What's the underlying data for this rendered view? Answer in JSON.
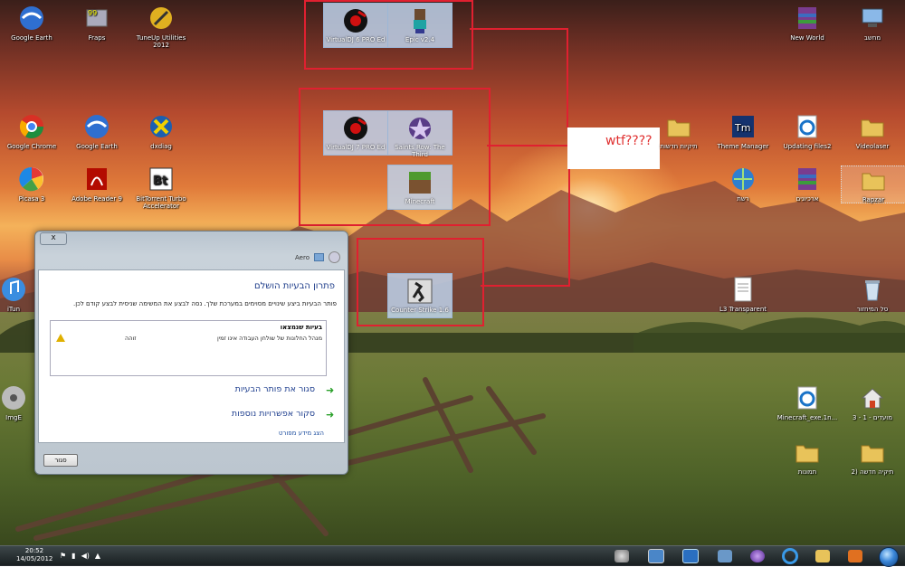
{
  "desktop": {
    "icons_left": [
      {
        "label": "Google Earth"
      },
      {
        "label": "Fraps",
        "badge": "99"
      },
      {
        "label": "TuneUp Utilities 2012"
      },
      {
        "label": "Google Chrome"
      },
      {
        "label": "Google Earth"
      },
      {
        "label": "dxdiag"
      },
      {
        "label": "Picasa 3"
      },
      {
        "label": "Adobe Reader 9"
      },
      {
        "label": "BitTorrent Turbo Accelerator"
      },
      {
        "label": "iTun"
      },
      {
        "label": "ImgE"
      }
    ],
    "icons_middle": [
      {
        "label": "VirtualDJ 6 PRO Ed"
      },
      {
        "label": "Epic v2.4"
      },
      {
        "label": "VirtualDJ 7 PRO Ed"
      },
      {
        "label": "Saints Row: The Third"
      },
      {
        "label": "Minecraft"
      },
      {
        "label": "Counter Strike 1.6"
      }
    ],
    "icons_right": [
      {
        "label": "New World"
      },
      {
        "label": "מחשב"
      },
      {
        "label": "תיקיות חדשות"
      },
      {
        "label": "Theme Manager"
      },
      {
        "label": "Updating files2"
      },
      {
        "label": "Videolaser"
      },
      {
        "label": "רשת"
      },
      {
        "label": "ארכיונים"
      },
      {
        "label": "Rapzar"
      },
      {
        "label": "L3 Transparent"
      },
      {
        "label": "סל המיחזור"
      },
      {
        "label": "Minecraft_exe.1n..."
      },
      {
        "label": "מועדים - 1 - 3"
      },
      {
        "label": "תמונות"
      },
      {
        "label": "תיקיה חדשה (2"
      }
    ]
  },
  "annotation": {
    "callout_text": "wtf????"
  },
  "dialog": {
    "close_label": "x",
    "toolbar_label": "Aero",
    "title": "פתרון הבעיות הושלם",
    "description": "פותר הבעיות ביצע שינויים מסוימים במערכת שלך. נסה לבצע את המשימה שניסית לבצע קודם לכן.",
    "issues_header": "בעיות שנמצאו",
    "issues": [
      {
        "text": "מנהל החלונות של שולחן העבודה אינו זמין",
        "status": "זוהה"
      }
    ],
    "actions": [
      {
        "label": "סגור את פותר הבעיות"
      },
      {
        "label": "סקור אפשרויות נוספות"
      }
    ],
    "more_info_link": "הצג מידע מפורט",
    "close_button": "סגור"
  },
  "taskbar": {
    "time": "20:52",
    "date": "14/05/2012"
  },
  "colors": {
    "annotation_red": "#e02030",
    "link_blue": "#1f3f8f",
    "title_blue": "#1e3d8a"
  }
}
